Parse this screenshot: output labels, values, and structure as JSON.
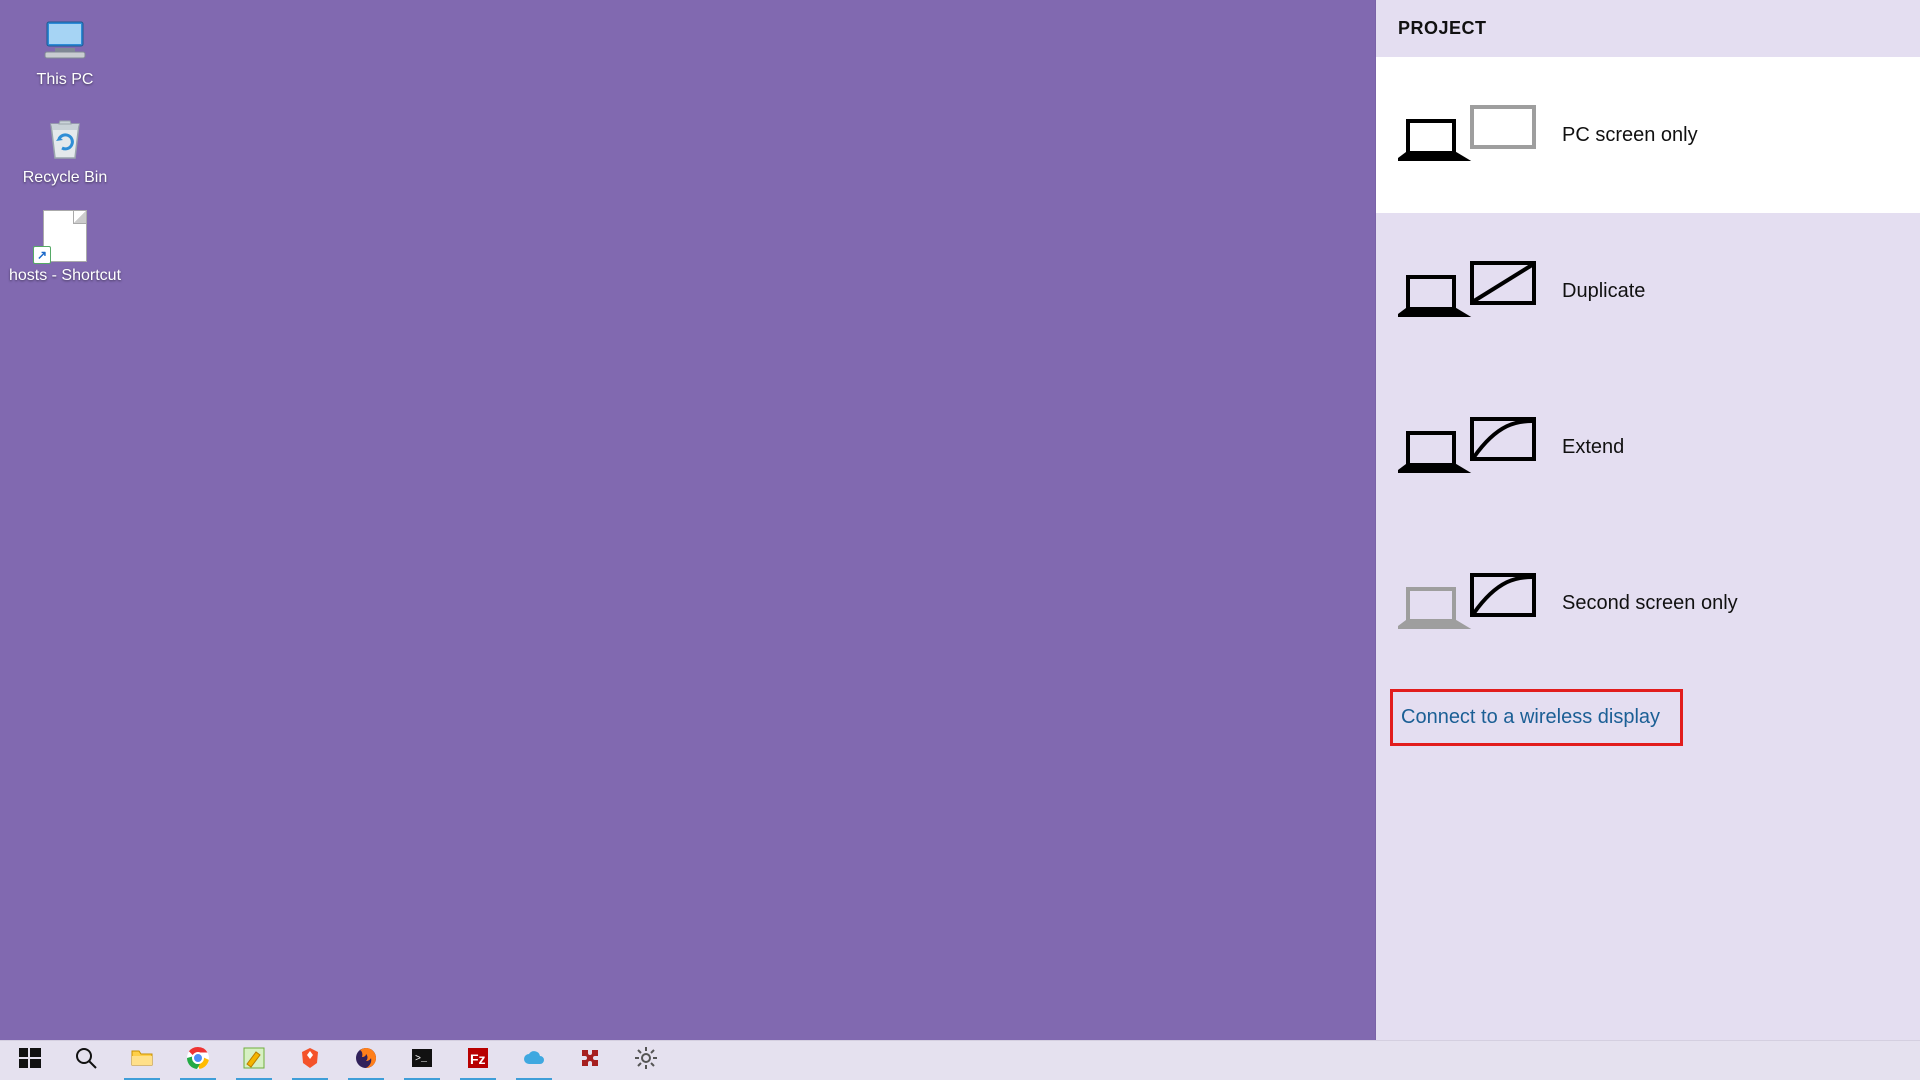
{
  "desktop": {
    "icons": [
      {
        "name": "this-pc",
        "label": "This PC"
      },
      {
        "name": "recycle-bin",
        "label": "Recycle Bin"
      },
      {
        "name": "hosts-file",
        "label": "hosts - Shortcut"
      }
    ]
  },
  "taskbar": {
    "items": [
      {
        "name": "start-button",
        "icon": "windows-logo-icon",
        "running": false
      },
      {
        "name": "search-button",
        "icon": "search-icon",
        "running": false
      },
      {
        "name": "file-explorer-app",
        "icon": "folder-icon",
        "running": true
      },
      {
        "name": "chrome-app",
        "icon": "chrome-icon",
        "running": true
      },
      {
        "name": "editor-app",
        "icon": "editor-icon",
        "running": true
      },
      {
        "name": "brave-app",
        "icon": "brave-icon",
        "running": true
      },
      {
        "name": "firefox-app",
        "icon": "firefox-icon",
        "running": true
      },
      {
        "name": "terminal-app",
        "icon": "terminal-icon",
        "running": true
      },
      {
        "name": "filezilla-app",
        "icon": "filezilla-icon",
        "running": true
      },
      {
        "name": "cloud-app",
        "icon": "cloud-icon",
        "running": true
      },
      {
        "name": "puzzle-app",
        "icon": "puzzle-icon",
        "running": false
      },
      {
        "name": "settings-app",
        "icon": "gear-icon",
        "running": false
      }
    ]
  },
  "project_panel": {
    "title": "PROJECT",
    "options": [
      {
        "key": "pc-only",
        "label": "PC screen only",
        "selected": true
      },
      {
        "key": "duplicate",
        "label": "Duplicate",
        "selected": false
      },
      {
        "key": "extend",
        "label": "Extend",
        "selected": false
      },
      {
        "key": "second-only",
        "label": "Second screen only",
        "selected": false
      }
    ],
    "wireless_link": "Connect to a wireless display",
    "highlight_wireless": true
  },
  "colors": {
    "desktop_bg": "#8169b0",
    "panel_bg": "#e4def1",
    "taskbar_bg": "#e5e1ef",
    "link": "#1b5f95",
    "highlight": "#e21d1d",
    "task_underline": "#3f9ed8"
  }
}
